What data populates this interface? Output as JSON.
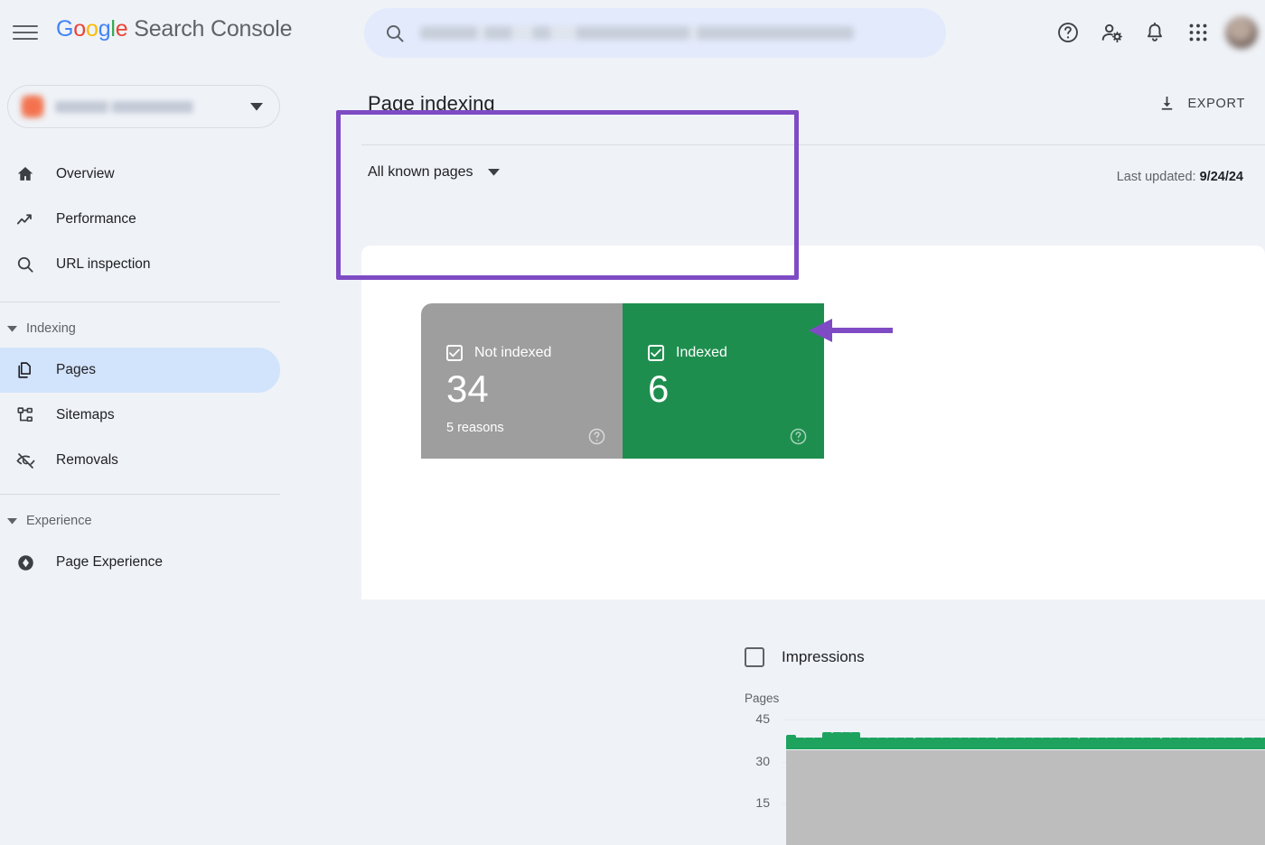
{
  "header": {
    "menu_icon": "hamburger-menu-icon",
    "brand_google": "Google",
    "brand_suffix": " Search Console",
    "search": {
      "placeholder": "",
      "icon": "search-icon",
      "redacted": true
    },
    "icons": [
      {
        "name": "help-icon",
        "label": "Help"
      },
      {
        "name": "user-settings-icon",
        "label": "Account settings"
      },
      {
        "name": "notifications-bell-icon",
        "label": "Notifications"
      },
      {
        "name": "apps-grid-icon",
        "label": "Google apps"
      }
    ],
    "avatar": {
      "name": "avatar",
      "redacted": true
    }
  },
  "sidebar": {
    "property_selector": {
      "label": "",
      "redacted": true,
      "caret_icon": "chevron-down-icon"
    },
    "items": [
      {
        "label": "Overview",
        "icon": "home-icon",
        "active": false
      },
      {
        "label": "Performance",
        "icon": "trending-up-icon",
        "active": false
      },
      {
        "label": "URL inspection",
        "icon": "search-icon",
        "active": false
      }
    ],
    "groups": [
      {
        "title": "Indexing",
        "caret_icon": "caret-down-icon",
        "items": [
          {
            "label": "Pages",
            "icon": "pages-copy-icon",
            "active": true
          },
          {
            "label": "Sitemaps",
            "icon": "sitemap-icon",
            "active": false
          },
          {
            "label": "Removals",
            "icon": "eye-off-icon",
            "active": false
          }
        ]
      },
      {
        "title": "Experience",
        "caret_icon": "caret-down-icon",
        "items": [
          {
            "label": "Page Experience",
            "icon": "page-experience-icon",
            "active": false
          }
        ]
      }
    ]
  },
  "main": {
    "title": "Page indexing",
    "export_label": "EXPORT",
    "export_icon": "download-icon",
    "filter_label": "All known pages",
    "filter_caret_icon": "caret-down-icon",
    "last_updated_label": "Last updated: ",
    "last_updated_value": "9/24/24",
    "cards": [
      {
        "id": "not-indexed",
        "label": "Not indexed",
        "value": "34",
        "sub": "5 reasons",
        "color": "#9e9e9e",
        "checked": true,
        "help_icon": "help-circle-icon"
      },
      {
        "id": "indexed",
        "label": "Indexed",
        "value": "6",
        "sub": "",
        "color": "#1e8e4e",
        "checked": true,
        "help_icon": "help-circle-icon"
      }
    ],
    "impressions": {
      "label": "Impressions",
      "checked": false
    },
    "annotation": {
      "color": "#7e4bc4",
      "arrow_direction": "left",
      "shape": "box-and-arrow"
    }
  },
  "chart_data": {
    "type": "bar",
    "stacked": true,
    "title": "",
    "ylabel": "Pages",
    "xlabel": "",
    "ylim": [
      0,
      48
    ],
    "yticks": [
      45,
      30,
      15
    ],
    "grid": true,
    "legend": [
      "Not indexed",
      "Indexed"
    ],
    "colors": {
      "Not indexed": "#bdbdbd",
      "Indexed": "#1ea35e"
    },
    "series": [
      {
        "name": "Not indexed",
        "values": [
          34,
          34,
          34,
          34,
          34,
          34,
          34,
          34,
          34,
          34,
          34,
          34,
          34,
          34,
          34,
          34,
          34,
          34,
          34,
          34,
          34,
          34,
          34,
          34,
          34,
          34,
          34,
          34,
          34,
          34,
          34,
          34,
          34,
          34,
          34,
          34,
          34,
          34,
          34,
          34,
          34,
          34,
          34,
          34,
          34,
          34,
          34,
          34,
          34,
          34,
          34,
          34,
          34,
          34,
          34,
          34,
          34,
          34,
          34,
          34,
          34,
          34,
          34,
          34,
          34,
          34,
          34,
          34,
          34,
          34,
          34,
          34,
          34,
          34,
          34,
          34,
          34,
          34,
          34,
          34,
          34,
          34,
          34,
          34,
          34,
          34,
          34,
          34,
          34,
          34
        ]
      },
      {
        "name": "Indexed",
        "values": [
          5,
          4,
          4,
          4,
          6,
          6,
          6,
          6,
          4,
          4,
          4,
          4,
          4,
          4,
          4,
          4,
          4,
          4,
          4,
          4,
          4,
          4,
          4,
          4,
          4,
          4,
          4,
          4,
          4,
          4,
          4,
          4,
          4,
          4,
          4,
          4,
          4,
          4,
          4,
          4,
          4,
          4,
          4,
          4,
          4,
          4,
          4,
          4,
          4,
          4,
          4,
          4,
          4,
          4,
          4,
          4,
          4,
          4,
          4,
          4,
          4,
          4,
          4,
          4,
          4,
          4,
          4,
          4,
          4,
          4,
          4,
          4,
          4,
          4,
          4,
          4,
          4,
          4,
          4,
          4,
          4,
          4,
          4,
          4,
          4,
          4,
          4,
          4,
          4,
          4
        ]
      }
    ]
  }
}
